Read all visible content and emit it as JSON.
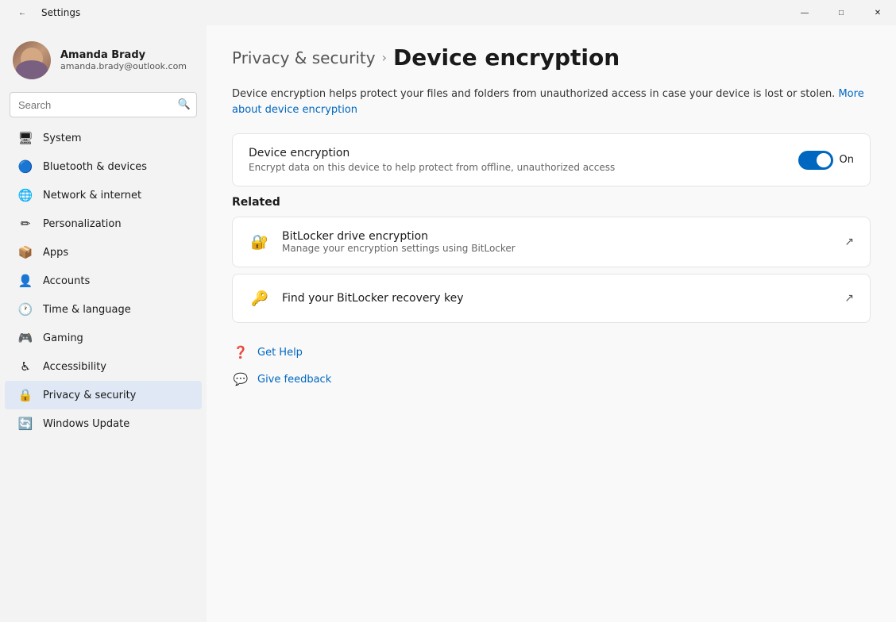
{
  "titlebar": {
    "title": "Settings",
    "back_icon": "←",
    "minimize": "—",
    "maximize": "□",
    "close": "✕"
  },
  "user": {
    "name": "Amanda Brady",
    "email": "amanda.brady@outlook.com"
  },
  "search": {
    "placeholder": "Search"
  },
  "nav": {
    "items": [
      {
        "id": "system",
        "label": "System",
        "icon": "🖥",
        "active": false
      },
      {
        "id": "bluetooth",
        "label": "Bluetooth & devices",
        "icon": "🔵",
        "active": false
      },
      {
        "id": "network",
        "label": "Network & internet",
        "icon": "🌐",
        "active": false
      },
      {
        "id": "personalization",
        "label": "Personalization",
        "icon": "✏",
        "active": false
      },
      {
        "id": "apps",
        "label": "Apps",
        "icon": "📦",
        "active": false
      },
      {
        "id": "accounts",
        "label": "Accounts",
        "icon": "👤",
        "active": false
      },
      {
        "id": "time",
        "label": "Time & language",
        "icon": "🕐",
        "active": false
      },
      {
        "id": "gaming",
        "label": "Gaming",
        "icon": "🎮",
        "active": false
      },
      {
        "id": "accessibility",
        "label": "Accessibility",
        "icon": "♿",
        "active": false
      },
      {
        "id": "privacy",
        "label": "Privacy & security",
        "icon": "🔒",
        "active": true
      },
      {
        "id": "windows-update",
        "label": "Windows Update",
        "icon": "🔄",
        "active": false
      }
    ]
  },
  "content": {
    "breadcrumb_parent": "Privacy & security",
    "breadcrumb_current": "Device encryption",
    "description_text": "Device encryption helps protect your files and folders from unauthorized access in case your device is lost or stolen.",
    "description_link": "More about device encryption",
    "device_encryption": {
      "name": "Device encryption",
      "desc": "Encrypt data on this device to help protect from offline, unauthorized access",
      "toggle_state": "On",
      "enabled": true
    },
    "related": {
      "label": "Related",
      "items": [
        {
          "name": "BitLocker drive encryption",
          "desc": "Manage your encryption settings using BitLocker",
          "has_external": true
        },
        {
          "name": "Find your BitLocker recovery key",
          "desc": "",
          "has_external": true
        }
      ]
    },
    "links": [
      {
        "id": "get-help",
        "label": "Get Help"
      },
      {
        "id": "give-feedback",
        "label": "Give feedback"
      }
    ]
  }
}
